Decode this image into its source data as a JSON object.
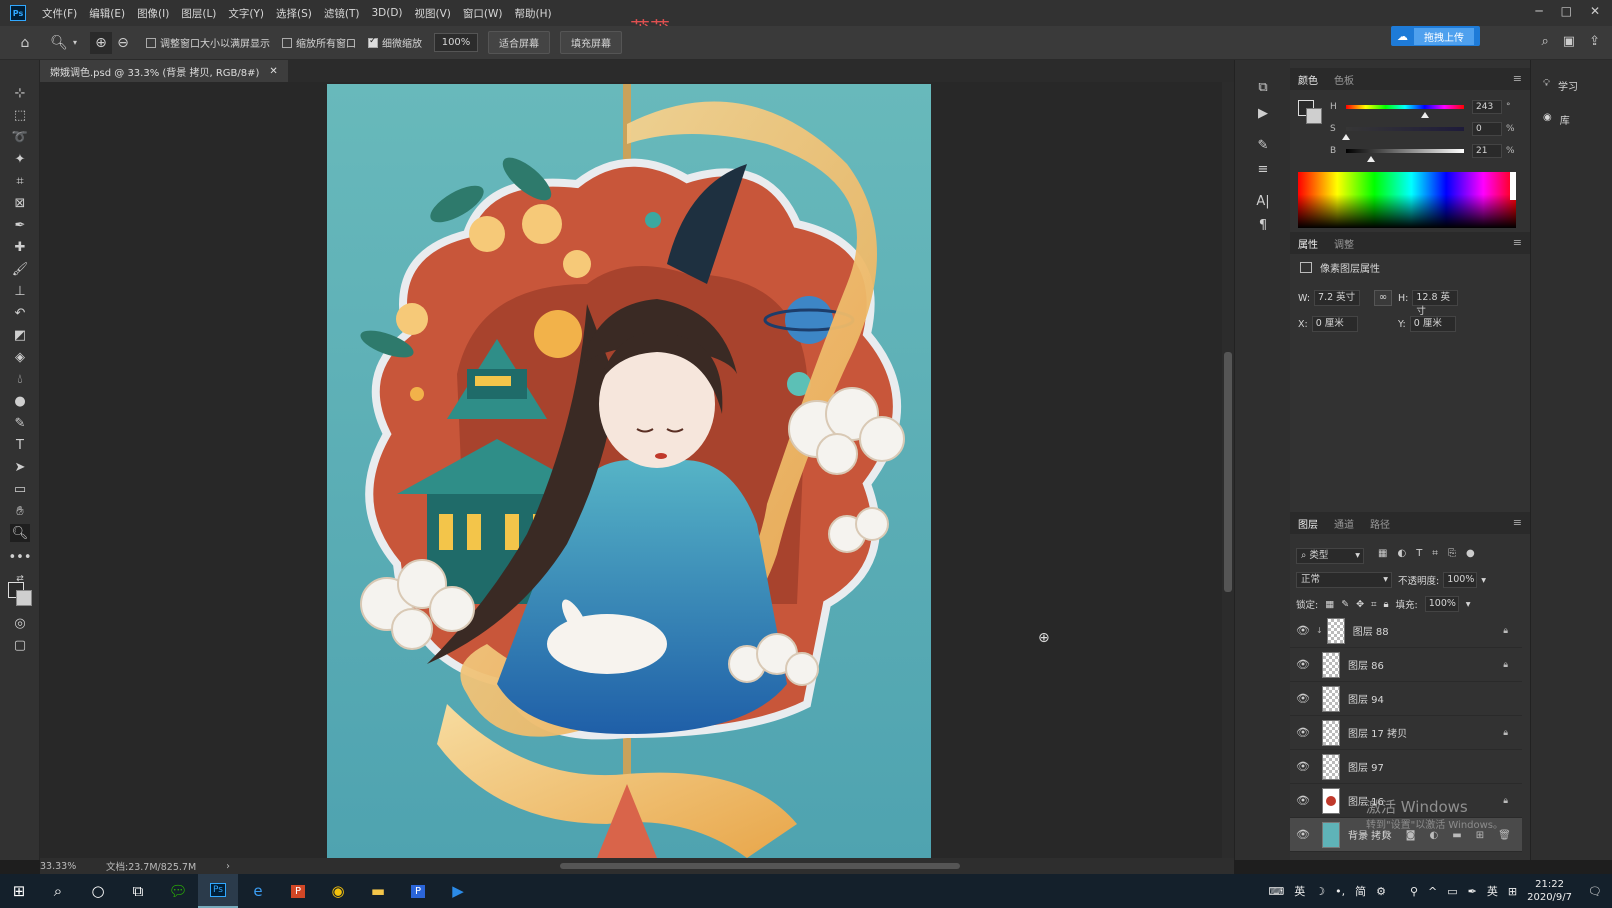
{
  "app": {
    "logo": "Ps",
    "watermark": "茂茂"
  },
  "menu": [
    "文件(F)",
    "编辑(E)",
    "图像(I)",
    "图层(L)",
    "文字(Y)",
    "选择(S)",
    "滤镜(T)",
    "3D(D)",
    "视图(V)",
    "窗口(W)",
    "帮助(H)"
  ],
  "options": {
    "check_resize": "调整窗口大小以满屏显示",
    "check_all": "缩放所有窗口",
    "check_scrubby": "细微缩放",
    "zoom_value": "100%",
    "fit_screen": "适合屏幕",
    "fill_screen": "填充屏幕",
    "upload": "拖拽上传"
  },
  "document": {
    "tab_title": "嫦娥调色.psd @ 33.3% (背景 拷贝, RGB/8#)",
    "zoom": "33.33%",
    "doc_size": "文档:23.7M/825.7M"
  },
  "color_panel": {
    "tabs": [
      "颜色",
      "色板"
    ],
    "h_label": "H",
    "h_value": "243",
    "h_unit": "°",
    "s_label": "S",
    "s_value": "0",
    "s_unit": "%",
    "b_label": "B",
    "b_value": "21",
    "b_unit": "%",
    "h_level": 0.67,
    "s_level": 0.0,
    "b_level": 0.21
  },
  "properties_panel": {
    "tabs": [
      "属性",
      "调整"
    ],
    "title": "像素图层属性",
    "w_label": "W:",
    "w_value": "7.2 英寸",
    "h_label": "H:",
    "h_value": "12.8 英寸",
    "x_label": "X:",
    "x_value": "0 厘米",
    "y_label": "Y:",
    "y_value": "0 厘米"
  },
  "layers_panel": {
    "tabs": [
      "图层",
      "通道",
      "路径"
    ],
    "filter": "类型",
    "blend_mode": "正常",
    "opacity_label": "不透明度:",
    "opacity_value": "100%",
    "lock_label": "锁定:",
    "fill_label": "填充:",
    "fill_value": "100%",
    "layers": [
      {
        "name": "图层 88",
        "locked": true
      },
      {
        "name": "图层 86",
        "locked": true
      },
      {
        "name": "图层 94",
        "locked": false
      },
      {
        "name": "图层 17 拷贝",
        "locked": true
      },
      {
        "name": "图层 97",
        "locked": false
      },
      {
        "name": "图层 16",
        "locked": true
      },
      {
        "name": "背景 拷贝",
        "locked": false
      }
    ]
  },
  "learn_panel": {
    "learn": "学习",
    "library": "库"
  },
  "windows_activation": {
    "title": "激活 Windows",
    "subtitle": "转到\"设置\"以激活 Windows。"
  },
  "taskbar": {
    "time": "21:22",
    "date": "2020/9/7",
    "ime_lang": "英",
    "ime_mode": "简",
    "lang2": "英"
  },
  "colors": {
    "accent": "#1e7bd8",
    "panel": "#323232",
    "canvas_bg": "#282828",
    "art_sky": "#5fb3b8",
    "art_red": "#c8563a"
  }
}
